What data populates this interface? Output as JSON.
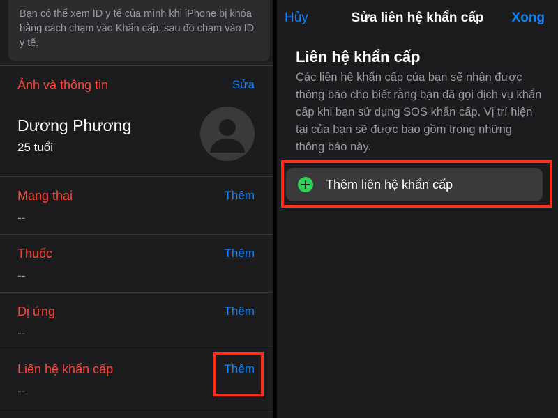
{
  "left": {
    "info_note": "Bạn có thể xem ID y tế của mình khi iPhone bị khóa bằng cách chạm vào Khẩn cấp, sau đó chạm vào ID y tế.",
    "photo_section": {
      "title": "Ảnh và thông tin",
      "action": "Sửa"
    },
    "profile": {
      "name": "Dương Phương",
      "age": "25 tuổi",
      "avatar_icon": "person-silhouette-icon"
    },
    "sections": [
      {
        "title": "Mang thai",
        "action": "Thêm",
        "value": "--"
      },
      {
        "title": "Thuốc",
        "action": "Thêm",
        "value": "--"
      },
      {
        "title": "Dị ứng",
        "action": "Thêm",
        "value": "--"
      },
      {
        "title": "Liên hệ khẩn cấp",
        "action": "Thêm",
        "value": "--"
      }
    ]
  },
  "right": {
    "nav": {
      "cancel": "Hủy",
      "title": "Sửa liên hệ khẩn cấp",
      "done": "Xong"
    },
    "heading": "Liên hệ khẩn cấp",
    "description": "Các liên hệ khẩn cấp của bạn sẽ nhận được thông báo cho biết rằng bạn đã gọi dịch vụ khẩn cấp khi bạn sử dụng SOS khẩn cấp. Vị trí hiện tại của bạn sẽ được bao gồm trong những thông báo này.",
    "add_button": {
      "label": "Thêm liên hệ khẩn cấp",
      "icon": "plus-circle-icon"
    }
  },
  "colors": {
    "background": "#1c1c1e",
    "accent_blue": "#0a84ff",
    "section_red": "#ff453a",
    "add_green": "#30d158",
    "highlight": "#ff2d1a"
  }
}
